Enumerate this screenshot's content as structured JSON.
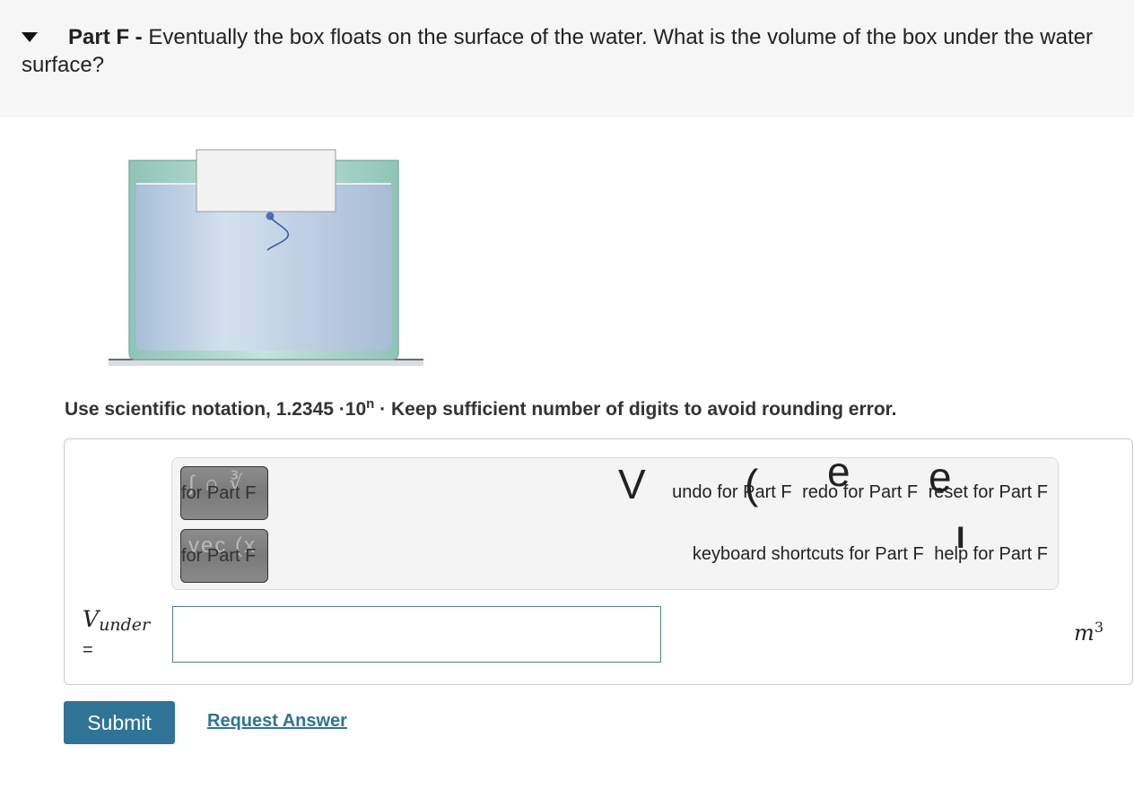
{
  "question": {
    "part_label": "Part F -",
    "text": "Eventually the box floats on the surface of the water. What is the volume of the box under the water surface?"
  },
  "instruction": {
    "prefix": "Use scientific notation, 1.2345 ·10",
    "exponent": "n",
    "suffix": "· Keep sufficient number of digits to avoid rounding error."
  },
  "toolbar": {
    "template_button": {
      "ghost_text": "∫ ∩ ∛",
      "label": "for Part F"
    },
    "vector_button": {
      "ghost_text": "vec (x",
      "label": "for Part F"
    },
    "undo_label": "undo for Part F",
    "redo_label": "redo for Part F",
    "reset_label": "reset for Part F",
    "keyboard_label": "keyboard shortcuts for Part F",
    "help_label": "help for Part F",
    "glyph_undo": "V",
    "glyph_redo": "(",
    "glyph_reset_1": "e",
    "glyph_reset_2": "e",
    "glyph_help": "I"
  },
  "answer": {
    "variable": "V",
    "subscript": "under",
    "equals": "=",
    "value": "",
    "unit": "m",
    "unit_exponent": "3"
  },
  "actions": {
    "submit_label": "Submit",
    "request_label": "Request Answer"
  },
  "colors": {
    "accent": "#2f7396",
    "water": "#b8cde3",
    "tank_glass": "#9fd0c4"
  }
}
